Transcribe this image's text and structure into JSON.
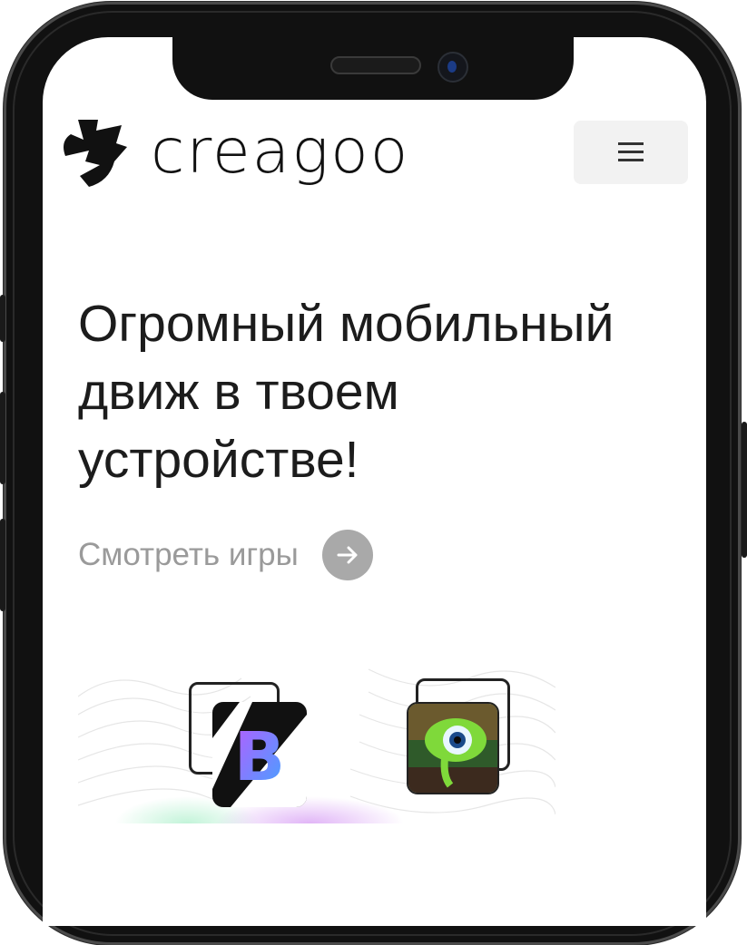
{
  "brand": {
    "name": "creagoo",
    "accent": "#111111"
  },
  "header": {
    "menu_icon": "hamburger-icon",
    "menu_bg": "#f2f2f2"
  },
  "hero": {
    "title": "Огромный мобильный движ в твоем устройстве!",
    "cta_label": "Смотреть игры",
    "cta_icon": "arrow-right-icon",
    "cta_color": "#9a9a9a"
  },
  "games": [
    {
      "icon": "letter-b-game-icon"
    },
    {
      "icon": "green-eye-game-icon"
    }
  ]
}
